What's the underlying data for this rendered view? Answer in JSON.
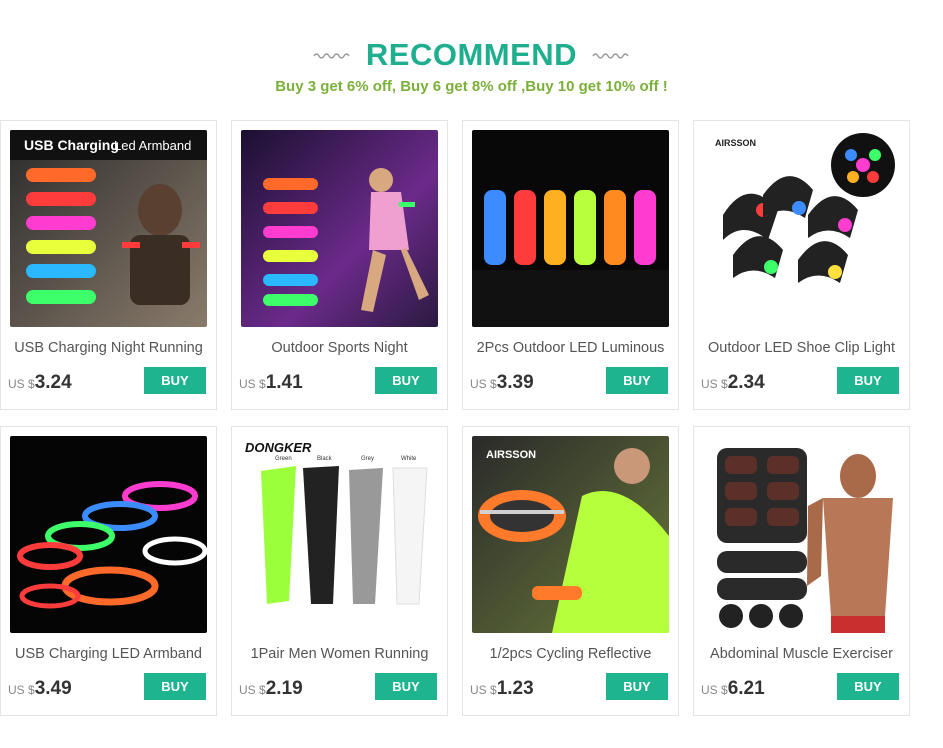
{
  "header": {
    "title": "RECOMMEND",
    "subtitle": "Buy 3 get 6% off, Buy 6 get 8% off ,Buy 10 get 10% off !"
  },
  "colors": {
    "accent": "#1fae8e",
    "promo": "#7bb03a",
    "buy_button": "#1db48f"
  },
  "products": [
    {
      "title": "USB Charging Night Running",
      "currency": "US $",
      "price": "3.24",
      "buy_label": "BUY",
      "image_icon": "led-armband-image",
      "image_text": [
        "USB Charging",
        "Led Armband"
      ]
    },
    {
      "title": "Outdoor Sports Night",
      "currency": "US $",
      "price": "1.41",
      "buy_label": "BUY",
      "image_icon": "runner-armband-image",
      "image_text": []
    },
    {
      "title": "2Pcs Outdoor LED Luminous",
      "currency": "US $",
      "price": "3.39",
      "buy_label": "BUY",
      "image_icon": "led-bands-image",
      "image_text": []
    },
    {
      "title": "Outdoor LED Shoe Clip Light",
      "currency": "US $",
      "price": "2.34",
      "buy_label": "BUY",
      "image_icon": "shoe-clip-image",
      "image_text": [
        "AIRSSON"
      ]
    },
    {
      "title": "USB Charging LED Armband",
      "currency": "US $",
      "price": "3.49",
      "buy_label": "BUY",
      "image_icon": "glowing-armbands-image",
      "image_text": []
    },
    {
      "title": "1Pair Men Women Running",
      "currency": "US $",
      "price": "2.19",
      "buy_label": "BUY",
      "image_icon": "arm-sleeves-image",
      "image_text": [
        "DONGKER",
        "Green",
        "Black",
        "Grey",
        "White"
      ]
    },
    {
      "title": "1/2pcs Cycling Reflective",
      "currency": "US $",
      "price": "1.23",
      "buy_label": "BUY",
      "image_icon": "reflective-band-image",
      "image_text": [
        "AIRSSON"
      ]
    },
    {
      "title": "Abdominal Muscle Exerciser",
      "currency": "US $",
      "price": "6.21",
      "buy_label": "BUY",
      "image_icon": "muscle-stimulator-image",
      "image_text": []
    }
  ]
}
